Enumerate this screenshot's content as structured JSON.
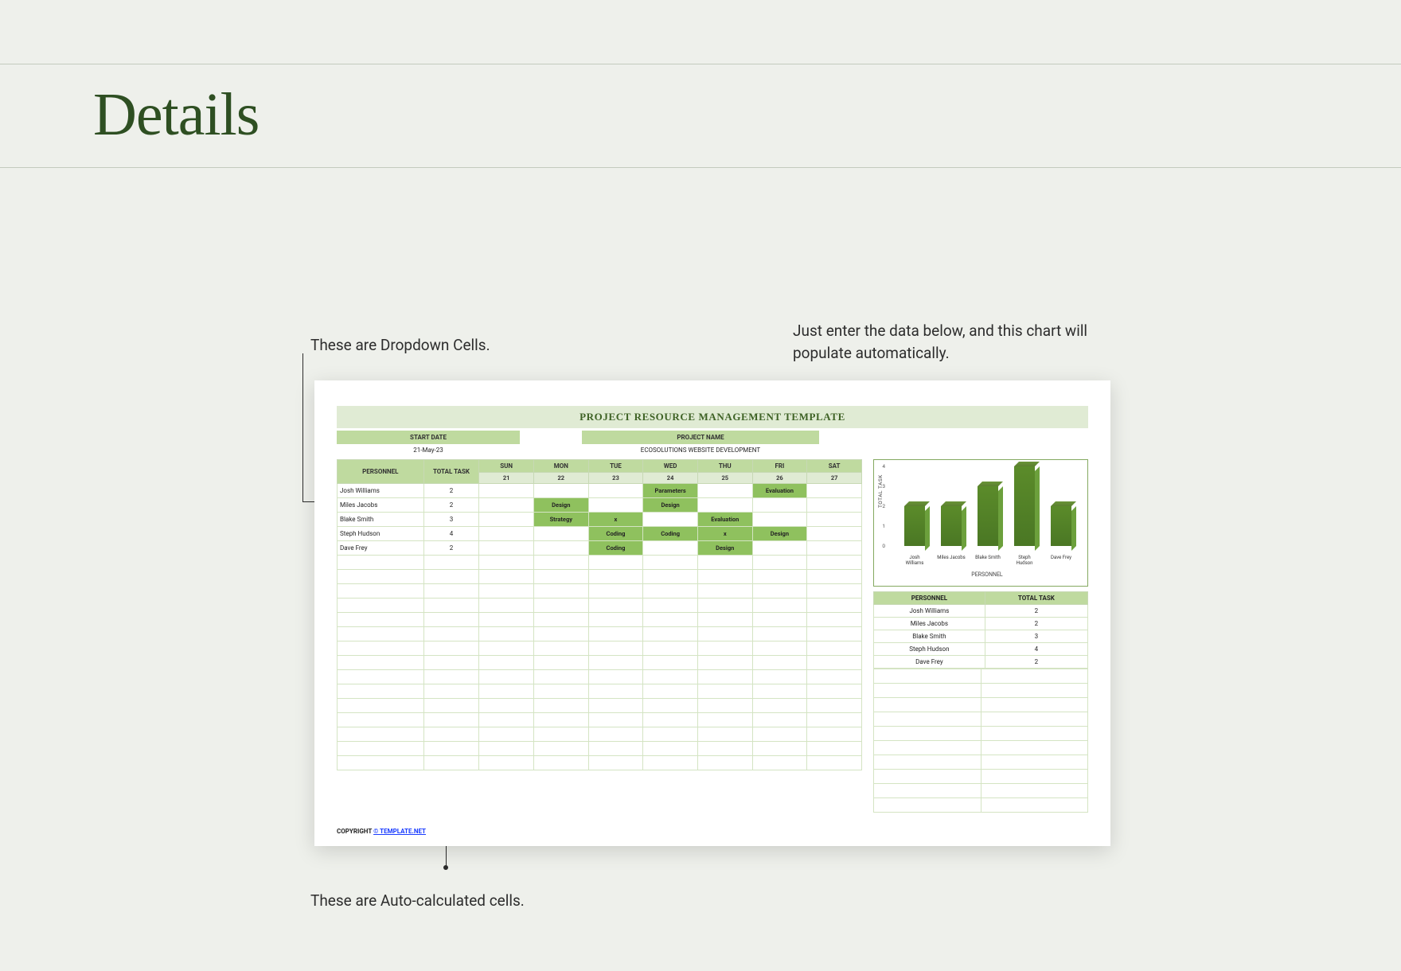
{
  "heading": "Details",
  "annotations": {
    "dropdown": "These are Dropdown Cells.",
    "chart_note": "Just enter the data below, and this chart will populate automatically.",
    "autocalc": "These are Auto-calculated cells."
  },
  "sheet": {
    "title": "PROJECT RESOURCE MANAGEMENT TEMPLATE",
    "labels": {
      "start_date_label": "START DATE",
      "start_date_value": "21-May-23",
      "project_name_label": "PROJECT NAME",
      "project_name_value": "ECOSOLUTIONS WEBSITE DEVELOPMENT",
      "personnel_header": "PERSONNEL",
      "total_task_header": "TOTAL TASK"
    },
    "day_headers": [
      {
        "day": "SUN",
        "num": "21"
      },
      {
        "day": "MON",
        "num": "22"
      },
      {
        "day": "TUE",
        "num": "23"
      },
      {
        "day": "WED",
        "num": "24"
      },
      {
        "day": "THU",
        "num": "25"
      },
      {
        "day": "FRI",
        "num": "26"
      },
      {
        "day": "SAT",
        "num": "27"
      }
    ],
    "rows": [
      {
        "name": "Josh Williams",
        "total": "2",
        "cells": [
          "",
          "",
          "",
          "Parameters",
          "",
          "Evaluation",
          ""
        ]
      },
      {
        "name": "Miles Jacobs",
        "total": "2",
        "cells": [
          "",
          "Design",
          "",
          "Design",
          "",
          "",
          ""
        ]
      },
      {
        "name": "Blake Smith",
        "total": "3",
        "cells": [
          "",
          "Strategy",
          "x",
          "",
          "Evaluation",
          "",
          ""
        ]
      },
      {
        "name": "Steph Hudson",
        "total": "4",
        "cells": [
          "",
          "",
          "Coding",
          "Coding",
          "x",
          "Design",
          ""
        ]
      },
      {
        "name": "Dave Frey",
        "total": "2",
        "cells": [
          "",
          "",
          "Coding",
          "",
          "Design",
          "",
          ""
        ]
      }
    ],
    "empty_rows": 15,
    "summary": [
      {
        "name": "Josh Williams",
        "total": "2"
      },
      {
        "name": "Miles Jacobs",
        "total": "2"
      },
      {
        "name": "Blake Smith",
        "total": "3"
      },
      {
        "name": "Steph Hudson",
        "total": "4"
      },
      {
        "name": "Dave Frey",
        "total": "2"
      }
    ],
    "copyright": {
      "text": "COPYRIGHT ",
      "link": "© TEMPLATE.NET"
    }
  },
  "chart_data": {
    "type": "bar",
    "categories": [
      "Josh Williams",
      "Miles Jacobs",
      "Blake Smith",
      "Steph Hudson",
      "Dave Frey"
    ],
    "values": [
      2,
      2,
      3,
      4,
      2
    ],
    "title": "",
    "xlabel": "PERSONNEL",
    "ylabel": "TOTAL TASK",
    "ylim": [
      0,
      4
    ],
    "yticks": [
      0,
      1,
      2,
      3,
      4
    ]
  }
}
